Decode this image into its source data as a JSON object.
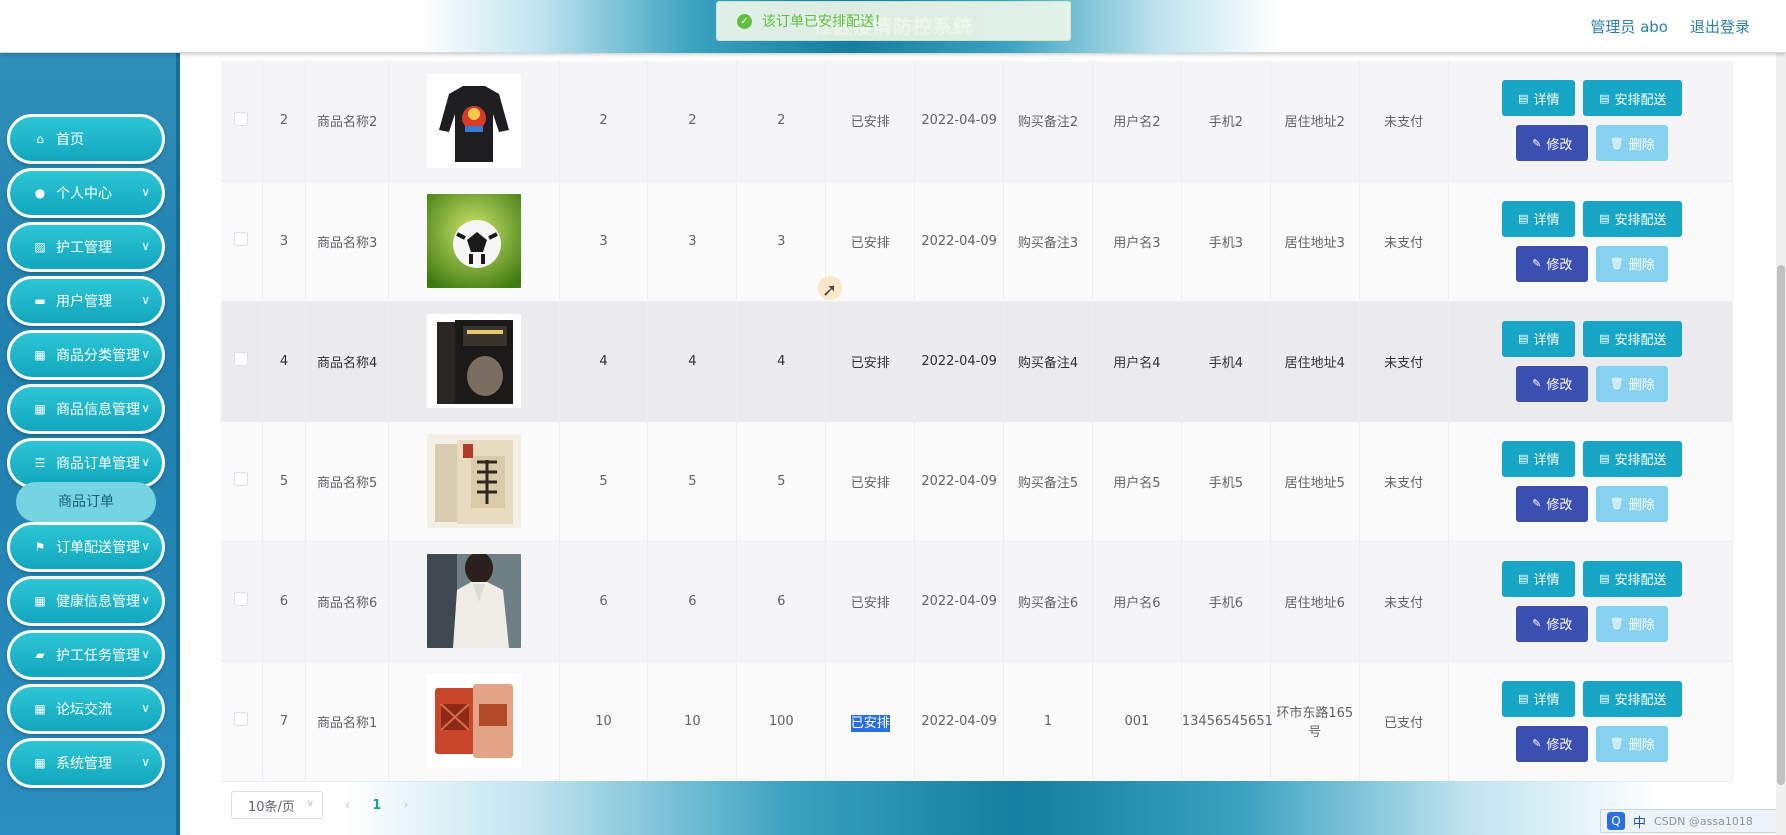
{
  "header": {
    "app_title": "社区疫情防控系统",
    "admin_label": "管理员 abo",
    "logout_label": "退出登录"
  },
  "toast": {
    "icon": "check-circle-icon",
    "text": "该订单已安排配送！"
  },
  "sidebar": {
    "items": [
      {
        "label": "首页",
        "icon": "home-icon",
        "has_children": false
      },
      {
        "label": "个人中心",
        "icon": "user-icon",
        "has_children": true
      },
      {
        "label": "护工管理",
        "icon": "chart-icon",
        "has_children": true
      },
      {
        "label": "用户管理",
        "icon": "monitor-icon",
        "has_children": true
      },
      {
        "label": "商品分类管理",
        "icon": "grid-icon",
        "has_children": true
      },
      {
        "label": "商品信息管理",
        "icon": "grid-icon",
        "has_children": true
      },
      {
        "label": "商品订单管理",
        "icon": "sliders-icon",
        "has_children": true
      },
      {
        "label": "订单配送管理",
        "icon": "flag-icon",
        "has_children": true
      },
      {
        "label": "健康信息管理",
        "icon": "grid-icon",
        "has_children": true
      },
      {
        "label": "护工任务管理",
        "icon": "ticket-icon",
        "has_children": true
      },
      {
        "label": "论坛交流",
        "icon": "grid-icon",
        "has_children": true
      },
      {
        "label": "系统管理",
        "icon": "grid-icon",
        "has_children": true
      }
    ],
    "submenu_active": "商品订单"
  },
  "table": {
    "rows": [
      {
        "index": "2",
        "name": "商品名称2",
        "image": "black-sweatshirt-photo",
        "c1": "2",
        "c2": "2",
        "c3": "2",
        "status": "已安排",
        "date": "2022-04-09",
        "note": "购买备注2",
        "user": "用户名2",
        "phone": "手机2",
        "address": "居住地址2",
        "pay": "未支付"
      },
      {
        "index": "3",
        "name": "商品名称3",
        "image": "soccer-ball-photo",
        "c1": "3",
        "c2": "3",
        "c3": "3",
        "status": "已安排",
        "date": "2022-04-09",
        "note": "购买备注3",
        "user": "用户名3",
        "phone": "手机3",
        "address": "居住地址3",
        "pay": "未支付"
      },
      {
        "index": "4",
        "name": "商品名称4",
        "image": "history-book-photo",
        "c1": "4",
        "c2": "4",
        "c3": "4",
        "status": "已安排",
        "date": "2022-04-09",
        "note": "购买备注4",
        "user": "用户名4",
        "phone": "手机4",
        "address": "居住地址4",
        "pay": "未支付"
      },
      {
        "index": "5",
        "name": "商品名称5",
        "image": "chinese-book-photo",
        "c1": "5",
        "c2": "5",
        "c3": "5",
        "status": "已安排",
        "date": "2022-04-09",
        "note": "购买备注5",
        "user": "用户名5",
        "phone": "手机5",
        "address": "居住地址5",
        "pay": "未支付"
      },
      {
        "index": "6",
        "name": "商品名称6",
        "image": "white-blouse-photo",
        "c1": "6",
        "c2": "6",
        "c3": "6",
        "status": "已安排",
        "date": "2022-04-09",
        "note": "购买备注6",
        "user": "用户名6",
        "phone": "手机6",
        "address": "居住地址6",
        "pay": "未支付"
      },
      {
        "index": "7",
        "name": "商品名称1",
        "image": "jerky-snack-photo",
        "c1": "10",
        "c2": "10",
        "c3": "100",
        "status": "已安排",
        "date": "2022-04-09",
        "note": "1",
        "user": "001",
        "phone": "13456545651",
        "address": "环市东路165号",
        "pay": "已支付"
      }
    ],
    "buttons": {
      "detail": "详情",
      "dispatch": "安排配送",
      "edit": "修改",
      "delete": "删除"
    }
  },
  "pagination": {
    "page_size": "10条/页",
    "prev_icon": "chevron-left-icon",
    "current_page": "1",
    "next_icon": "chevron-right-icon"
  },
  "ime": {
    "mode": "中",
    "watermark": "CSDN @assa1018"
  },
  "colors": {
    "sidebar_bg": "#1f7fae",
    "menu_bg": "#12a6bd",
    "btn_primary": "#17a6c6",
    "btn_edit": "#3b4fb0",
    "btn_delete": "#86d2f0",
    "toast_success": "#67c23a"
  }
}
